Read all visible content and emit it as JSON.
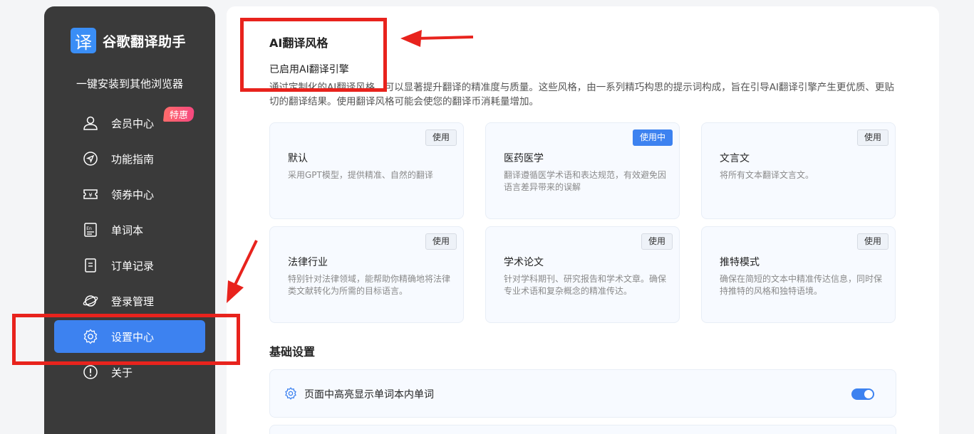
{
  "sidebar": {
    "logo_char": "译",
    "brand": "谷歌翻译助手",
    "install": "一键安装到其他浏览器",
    "items": [
      {
        "label": "会员中心",
        "icon": "user-icon",
        "badge": "特惠"
      },
      {
        "label": "功能指南",
        "icon": "send-icon"
      },
      {
        "label": "领券中心",
        "icon": "coupon-icon"
      },
      {
        "label": "单词本",
        "icon": "wordbook-icon"
      },
      {
        "label": "订单记录",
        "icon": "order-icon"
      },
      {
        "label": "登录管理",
        "icon": "planet-icon"
      },
      {
        "label": "设置中心",
        "icon": "gear-icon",
        "active": true
      },
      {
        "label": "关于",
        "icon": "info-icon"
      }
    ]
  },
  "main": {
    "ai_style": {
      "title": "AI翻译风格",
      "subtitle": "已启用AI翻译引擎",
      "description": "通过定制化的AI翻译风格，可以显著提升翻译的精准度与质量。这些风格，由一系列精巧构思的提示词构成，旨在引导AI翻译引擎产生更优质、更贴切的翻译结果。使用翻译风格可能会使您的翻译币消耗量增加。",
      "cards": [
        {
          "title": "默认",
          "desc": "采用GPT模型，提供精准、自然的翻译",
          "button": "使用",
          "active": false
        },
        {
          "title": "医药医学",
          "desc": "翻译遵循医学术语和表达规范，有效避免因语言差异带来的误解",
          "button": "使用中",
          "active": true
        },
        {
          "title": "文言文",
          "desc": "将所有文本翻译文言文。",
          "button": "使用",
          "active": false
        },
        {
          "title": "法律行业",
          "desc": "特别针对法律领域，能帮助你精确地将法律类文献转化为所需的目标语言。",
          "button": "使用",
          "active": false
        },
        {
          "title": "学术论文",
          "desc": "针对学科期刊、研究报告和学术文章。确保专业术语和复杂概念的精准传达。",
          "button": "使用",
          "active": false
        },
        {
          "title": "推特模式",
          "desc": "确保在简短的文本中精准传达信息，同时保持推特的风格和独特语境。",
          "button": "使用",
          "active": false
        }
      ]
    },
    "basic": {
      "title": "基础设置",
      "settings": [
        {
          "label": "页面中高亮显示单词本内单词",
          "enabled": true
        }
      ]
    }
  },
  "colors": {
    "accent": "#3d82f0",
    "sidebar_bg": "#3a3a3a",
    "annotation": "#e8231d"
  }
}
